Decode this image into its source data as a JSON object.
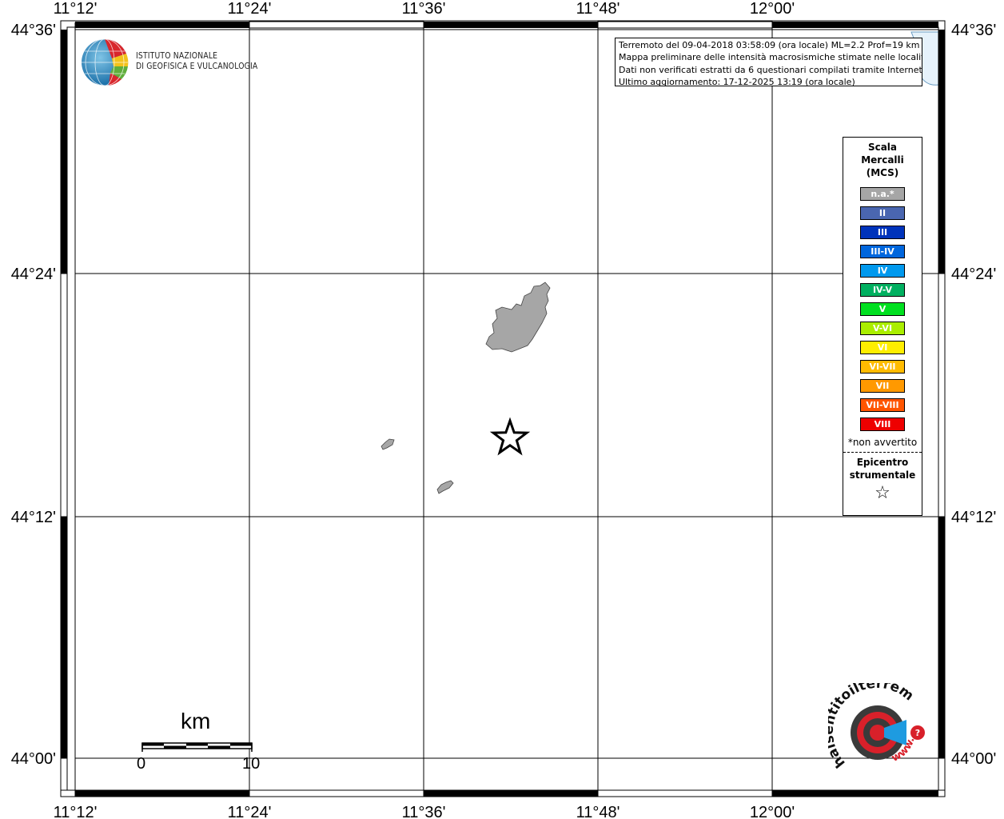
{
  "map": {
    "lon_labels_top": [
      "11°12'",
      "11°24'",
      "11°36'",
      "11°48'",
      "12°00'"
    ],
    "lon_labels_bottom": [
      "11°12'",
      "11°24'",
      "11°36'",
      "11°48'",
      "12°00'"
    ],
    "lat_labels_left": [
      "44°36'",
      "44°24'",
      "44°12'",
      "44°00'"
    ],
    "lat_labels_right": [
      "44°36'",
      "44°24'",
      "44°12'",
      "44°00'"
    ],
    "colors": {
      "municipality_fill": "#a6a6a6",
      "grid": "#000000",
      "sea": "#e6f2fb"
    }
  },
  "institute": {
    "name_line1": "ISTITUTO NAZIONALE",
    "name_line2": "DI GEOFISICA E VULCANOLOGIA"
  },
  "info_box": {
    "line1": "Terremoto del 09-04-2018 03:58:09 (ora locale) ML=2.2 Prof=19 km",
    "line2": "Mappa preliminare delle intensità macrosismiche stimate nelle località",
    "line3": "Dati non verificati estratti da 6 questionari compilati tramite Internet.",
    "line4": "Ultimo aggiornamento: 17-12-2025 13:19 (ora locale)"
  },
  "legend": {
    "title_line1": "Scala",
    "title_line2": "Mercalli",
    "title_line3": "(MCS)",
    "items": [
      {
        "label": "n.a.*",
        "color": "#a6a6a6"
      },
      {
        "label": "II",
        "color": "#4a66b0"
      },
      {
        "label": "III",
        "color": "#0033bb"
      },
      {
        "label": "III-IV",
        "color": "#0066dd"
      },
      {
        "label": "IV",
        "color": "#0099ee"
      },
      {
        "label": "IV-V",
        "color": "#00b060"
      },
      {
        "label": "V",
        "color": "#00e020"
      },
      {
        "label": "V-VI",
        "color": "#aaee00"
      },
      {
        "label": "VI",
        "color": "#ffee00"
      },
      {
        "label": "VI-VII",
        "color": "#ffbb00"
      },
      {
        "label": "VII",
        "color": "#ff9900"
      },
      {
        "label": "VII-VIII",
        "color": "#ff5500"
      },
      {
        "label": "VIII",
        "color": "#ee0000"
      }
    ],
    "note": "*non avvertito",
    "epicenter_line1": "Epicentro",
    "epicenter_line2": "strumentale",
    "epicenter_symbol": "☆"
  },
  "scale_bar": {
    "unit": "km",
    "start_label": "0",
    "end_label": "10"
  },
  "logo_hst": {
    "text": "haisentitoilterremoto.it",
    "www": "www."
  }
}
